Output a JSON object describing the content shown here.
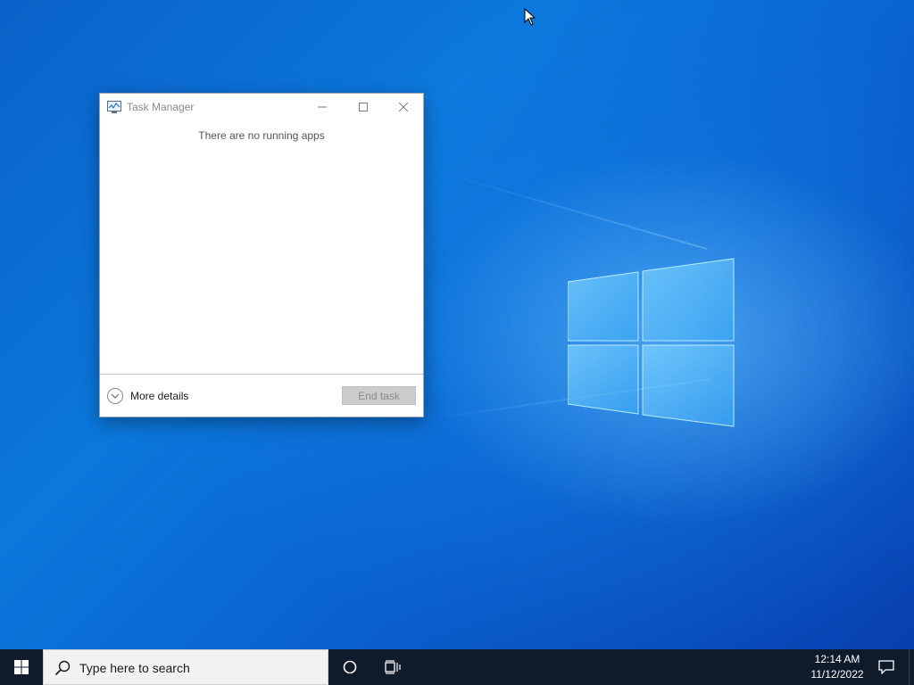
{
  "colors": {
    "desktop_blue": "#0b78dc",
    "taskbar": "#0f1a2b",
    "search_box": "#f2f2f2"
  },
  "task_manager": {
    "title": "Task Manager",
    "app_icon": "task-manager-icon",
    "caption_buttons": [
      "minimize-icon",
      "maximize-icon",
      "close-icon"
    ],
    "empty_message": "There are no running apps",
    "more_details_label": "More details",
    "more_details_icon": "chevron-down-icon",
    "end_task_label": "End task",
    "end_task_enabled": false
  },
  "taskbar": {
    "start_icon": "windows-logo-icon",
    "search_placeholder": "Type here to search",
    "search_icon": "search-icon",
    "cortana_icon": "cortana-circle-icon",
    "task_view_icon": "task-view-icon",
    "clock": {
      "time": "12:14 AM",
      "date": "11/12/2022"
    },
    "notification_icon": "action-center-icon"
  }
}
